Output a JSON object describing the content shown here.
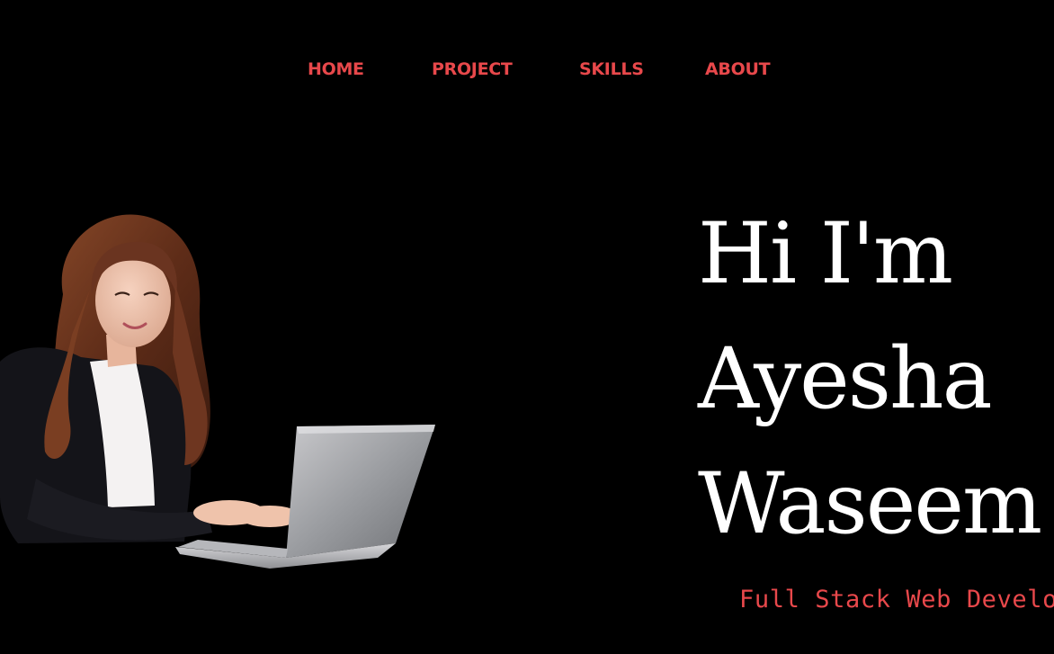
{
  "nav": {
    "items": [
      {
        "label": "HOME"
      },
      {
        "label": "PROJECT"
      },
      {
        "label": "SKILLS"
      },
      {
        "label": "ABOUT"
      }
    ]
  },
  "hero": {
    "lines": [
      "Hi I'm",
      "Ayesha",
      "Waseem"
    ],
    "subtitle": "Full Stack Web Developer"
  },
  "illustration": {
    "icon": "woman-with-laptop-photo"
  },
  "colors": {
    "background": "#000000",
    "accent": "#e8484b",
    "heading": "#ffffff"
  }
}
